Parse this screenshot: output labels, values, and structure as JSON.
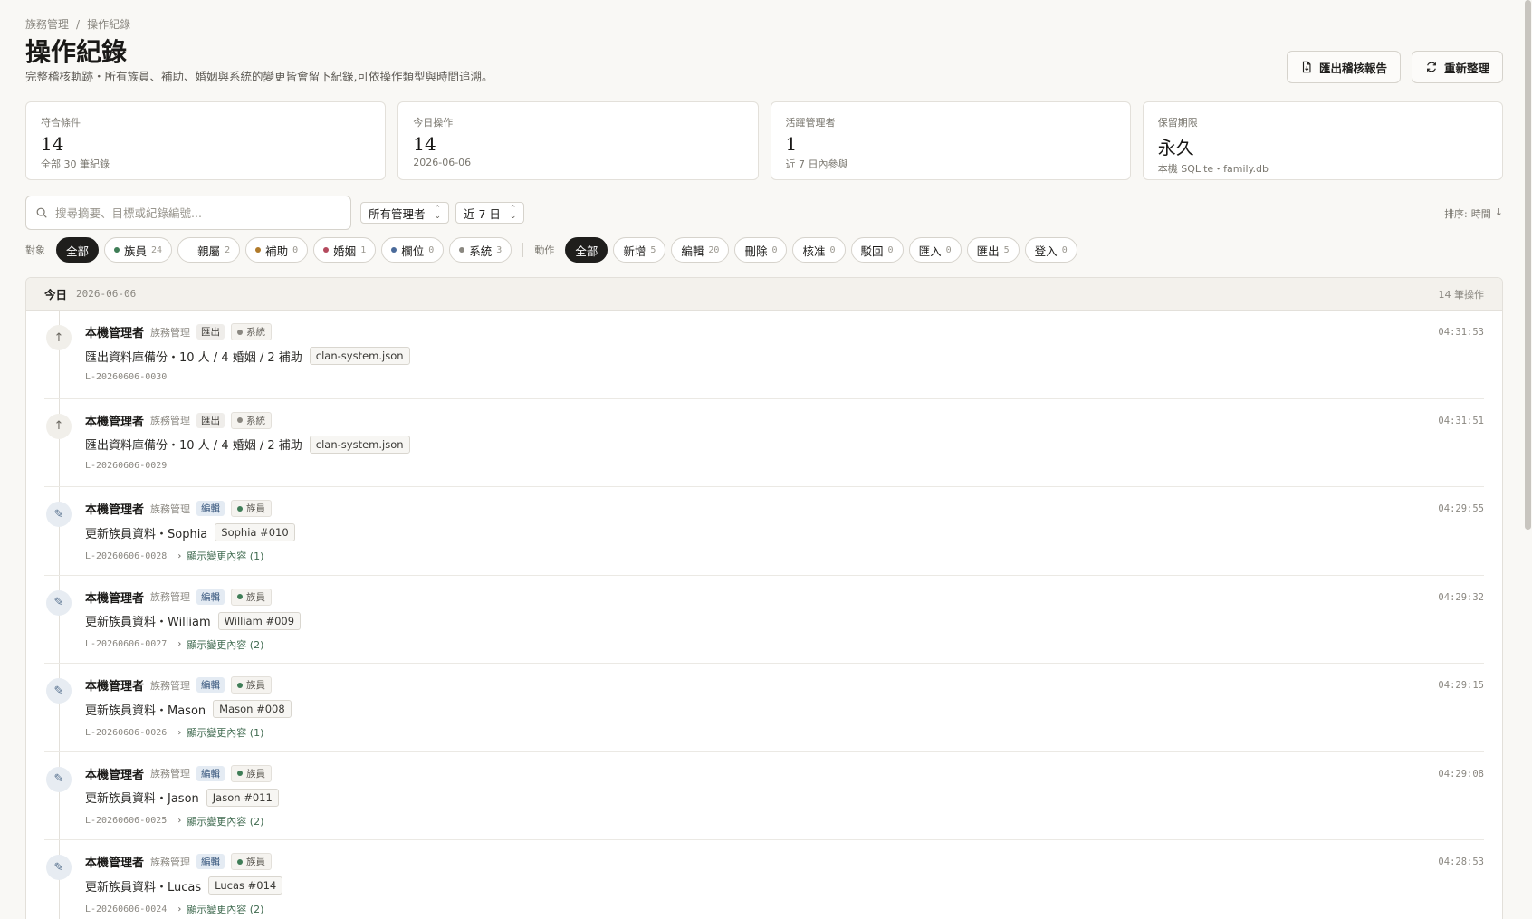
{
  "breadcrumb": {
    "parent": "族務管理",
    "separator": "/",
    "current": "操作紀錄"
  },
  "title": "操作紀錄",
  "subtitle": "完整稽核軌跡・所有族員、補助、婚姻與系統的變更皆會留下紀錄,可依操作類型與時間追溯。",
  "actions": {
    "export_label": "匯出稽核報告",
    "refresh_label": "重新整理"
  },
  "stats": [
    {
      "label": "符合條件",
      "value": "14",
      "hint": "全部 30 筆紀錄"
    },
    {
      "label": "今日操作",
      "value": "14",
      "hint": "2026-06-06"
    },
    {
      "label": "活躍管理者",
      "value": "1",
      "hint": "近 7 日內參與"
    },
    {
      "label": "保留期限",
      "value": "永久",
      "hint": "本機 SQLite・family.db"
    }
  ],
  "search": {
    "placeholder": "搜尋摘要、目標或紀錄編號..."
  },
  "selects": {
    "admin": "所有管理者",
    "range": "近 7 日"
  },
  "sort": {
    "label": "排序:",
    "value": "時間",
    "arrow": "↓"
  },
  "filters": {
    "object_label": "對象",
    "objects": [
      {
        "label": "全部",
        "count": ""
      },
      {
        "label": "族員",
        "count": "24"
      },
      {
        "label": "親屬",
        "count": "2"
      },
      {
        "label": "補助",
        "count": "0"
      },
      {
        "label": "婚姻",
        "count": "1"
      },
      {
        "label": "欄位",
        "count": "0"
      },
      {
        "label": "系統",
        "count": "3"
      }
    ],
    "action_label": "動作",
    "actions": [
      {
        "label": "全部",
        "count": ""
      },
      {
        "label": "新增",
        "count": "5"
      },
      {
        "label": "編輯",
        "count": "20"
      },
      {
        "label": "刪除",
        "count": "0"
      },
      {
        "label": "核准",
        "count": "0"
      },
      {
        "label": "駁回",
        "count": "0"
      },
      {
        "label": "匯入",
        "count": "0"
      },
      {
        "label": "匯出",
        "count": "5"
      },
      {
        "label": "登入",
        "count": "0"
      }
    ]
  },
  "colors": {
    "member": "#3f7d57",
    "subsidy": "#b07a2a",
    "marriage": "#b44a5e",
    "field": "#4a6a9a",
    "system": "#8a8780"
  },
  "group": {
    "title": "今日",
    "date": "2026-06-06",
    "count": "14 筆操作"
  },
  "entries": [
    {
      "actor": "本機管理者",
      "role": "族務管理",
      "action": "匯出",
      "object": "系統",
      "summary": "匯出資料庫備份・10 人 / 4 婚姻 / 2 補助",
      "ref": "clan-system.json",
      "id": "L-20260606-0030",
      "diff": "",
      "time": "04:31:53",
      "icon": "↑"
    },
    {
      "actor": "本機管理者",
      "role": "族務管理",
      "action": "匯出",
      "object": "系統",
      "summary": "匯出資料庫備份・10 人 / 4 婚姻 / 2 補助",
      "ref": "clan-system.json",
      "id": "L-20260606-0029",
      "diff": "",
      "time": "04:31:51",
      "icon": "↑"
    },
    {
      "actor": "本機管理者",
      "role": "族務管理",
      "action": "編輯",
      "object": "族員",
      "summary": "更新族員資料・Sophia",
      "ref": "Sophia #010",
      "id": "L-20260606-0028",
      "diff": "顯示變更內容 (1)",
      "time": "04:29:55",
      "icon": "✎"
    },
    {
      "actor": "本機管理者",
      "role": "族務管理",
      "action": "編輯",
      "object": "族員",
      "summary": "更新族員資料・William",
      "ref": "William #009",
      "id": "L-20260606-0027",
      "diff": "顯示變更內容 (2)",
      "time": "04:29:32",
      "icon": "✎"
    },
    {
      "actor": "本機管理者",
      "role": "族務管理",
      "action": "編輯",
      "object": "族員",
      "summary": "更新族員資料・Mason",
      "ref": "Mason #008",
      "id": "L-20260606-0026",
      "diff": "顯示變更內容 (1)",
      "time": "04:29:15",
      "icon": "✎"
    },
    {
      "actor": "本機管理者",
      "role": "族務管理",
      "action": "編輯",
      "object": "族員",
      "summary": "更新族員資料・Jason",
      "ref": "Jason #011",
      "id": "L-20260606-0025",
      "diff": "顯示變更內容 (2)",
      "time": "04:29:08",
      "icon": "✎"
    },
    {
      "actor": "本機管理者",
      "role": "族務管理",
      "action": "編輯",
      "object": "族員",
      "summary": "更新族員資料・Lucas",
      "ref": "Lucas #014",
      "id": "L-20260606-0024",
      "diff": "顯示變更內容 (2)",
      "time": "04:28:53",
      "icon": "✎"
    }
  ]
}
